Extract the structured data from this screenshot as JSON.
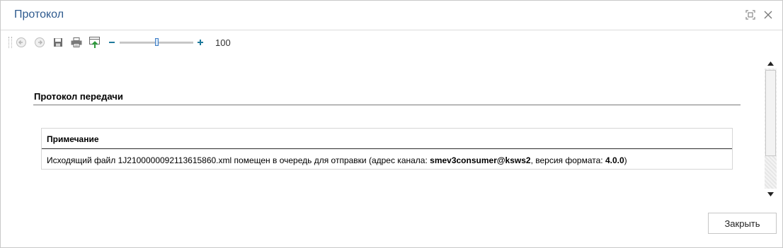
{
  "window": {
    "title": "Протокол",
    "restore_icon": "restore-window-icon",
    "close_icon": "close-icon"
  },
  "toolbar": {
    "icons": [
      "back-icon",
      "forward-icon",
      "save-icon",
      "print-icon",
      "export-icon",
      "zoom-out-icon",
      "zoom-in-icon"
    ],
    "zoom_value": "100",
    "zoom_level_fraction": 0.5
  },
  "report": {
    "title": "Протокол передачи",
    "table": {
      "header": "Примечание",
      "row_text_1": "Исходящий файл 1J2100000092113615860.xml помещен в очередь для отправки (адрес канала: ",
      "channel": "smev3consumer@ksws2",
      "row_text_2": ", версия формата: ",
      "format_version": "4.0.0",
      "row_text_3": ")"
    }
  },
  "footer": {
    "close_label": "Закрыть"
  },
  "colors": {
    "title": "#2e5a8e",
    "zoom_accent": "#3c7cc6",
    "plus_minus_accent": "#1f7a9c"
  }
}
